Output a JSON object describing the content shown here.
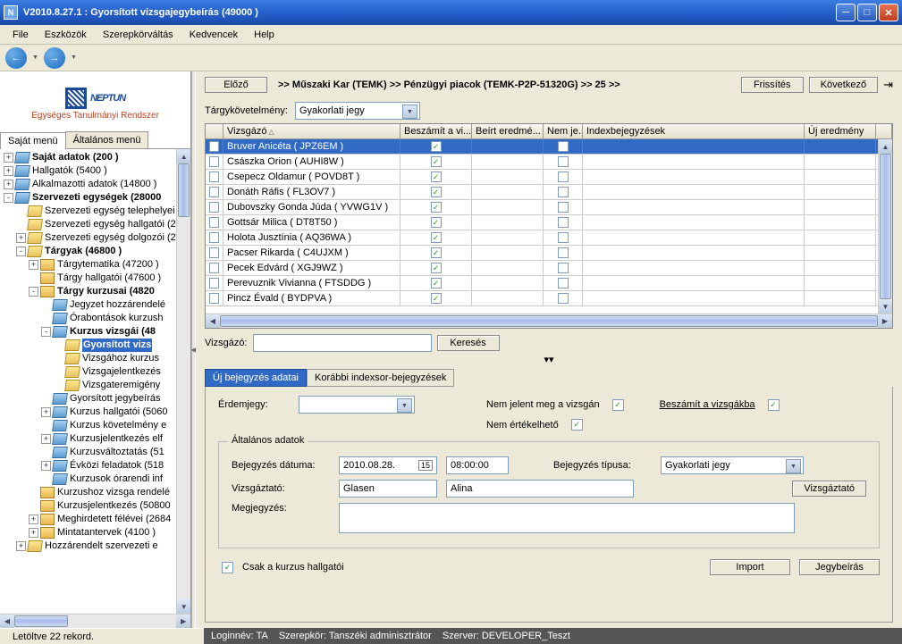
{
  "window": {
    "title": "V2010.8.27.1 : Gyorsított vizsgajegybeírás (49000  )",
    "icon_letter": "N"
  },
  "menu": [
    "File",
    "Eszközök",
    "Szerepkörváltás",
    "Kedvencek",
    "Help"
  ],
  "logo": {
    "brand": "NEPTUN",
    "tagline": "Egységes Tanulmányi Rendszer"
  },
  "left_tabs": {
    "active": "Saját menü",
    "other": "Általános menü"
  },
  "tree": [
    {
      "depth": 0,
      "exp": "+",
      "icon": "blue",
      "label": "Saját adatok (200  )",
      "bold": true
    },
    {
      "depth": 0,
      "exp": "+",
      "icon": "blue",
      "label": "Hallgatók (5400  )",
      "bold": false
    },
    {
      "depth": 0,
      "exp": "+",
      "icon": "blue",
      "label": "Alkalmazotti adatok (14800  )",
      "bold": false
    },
    {
      "depth": 0,
      "exp": "-",
      "icon": "blue",
      "label": "Szervezeti egységek (28000",
      "bold": true
    },
    {
      "depth": 1,
      "exp": "",
      "icon": "yellow",
      "label": "Szervezeti egység telephelyei",
      "bold": false
    },
    {
      "depth": 1,
      "exp": "",
      "icon": "yellow",
      "label": "Szervezeti egység hallgatói (2",
      "bold": false
    },
    {
      "depth": 1,
      "exp": "+",
      "icon": "yellow",
      "label": "Szervezeti egység dolgozói (2",
      "bold": false
    },
    {
      "depth": 1,
      "exp": "-",
      "icon": "yellow",
      "label": "Tárgyak (46800  )",
      "bold": true
    },
    {
      "depth": 2,
      "exp": "+",
      "icon": "folder",
      "label": "Tárgytematika (47200  )",
      "bold": false
    },
    {
      "depth": 2,
      "exp": "",
      "icon": "folder",
      "label": "Tárgy hallgatói (47600  )",
      "bold": false
    },
    {
      "depth": 2,
      "exp": "-",
      "icon": "folder",
      "label": "Tárgy kurzusai (4820",
      "bold": true
    },
    {
      "depth": 3,
      "exp": "",
      "icon": "blue",
      "label": "Jegyzet hozzárendelé",
      "bold": false
    },
    {
      "depth": 3,
      "exp": "",
      "icon": "blue",
      "label": "Órabontások kurzush",
      "bold": false
    },
    {
      "depth": 3,
      "exp": "-",
      "icon": "blue",
      "label": "Kurzus vizsgái (48",
      "bold": true
    },
    {
      "depth": 4,
      "exp": "",
      "icon": "yellow",
      "label": "Gyorsított vizs",
      "bold": true,
      "selected": true
    },
    {
      "depth": 4,
      "exp": "",
      "icon": "yellow",
      "label": "Vizsgához kurzus",
      "bold": false
    },
    {
      "depth": 4,
      "exp": "",
      "icon": "yellow",
      "label": "Vizsgajelentkezés",
      "bold": false
    },
    {
      "depth": 4,
      "exp": "",
      "icon": "yellow",
      "label": "Vizsgateremigény",
      "bold": false
    },
    {
      "depth": 3,
      "exp": "",
      "icon": "blue",
      "label": "Gyorsított jegybeírás",
      "bold": false
    },
    {
      "depth": 3,
      "exp": "+",
      "icon": "blue",
      "label": "Kurzus hallgatói (5060",
      "bold": false
    },
    {
      "depth": 3,
      "exp": "",
      "icon": "blue",
      "label": "Kurzus követelmény e",
      "bold": false
    },
    {
      "depth": 3,
      "exp": "+",
      "icon": "blue",
      "label": "Kurzusjelentkezés elf",
      "bold": false
    },
    {
      "depth": 3,
      "exp": "",
      "icon": "blue",
      "label": "Kurzusváltoztatás (51",
      "bold": false
    },
    {
      "depth": 3,
      "exp": "+",
      "icon": "blue",
      "label": "Évközi feladatok (518",
      "bold": false
    },
    {
      "depth": 3,
      "exp": "",
      "icon": "blue",
      "label": "Kurzusok órarendi inf",
      "bold": false
    },
    {
      "depth": 2,
      "exp": "",
      "icon": "folder",
      "label": "Kurzushoz vizsga rendelé",
      "bold": false
    },
    {
      "depth": 2,
      "exp": "",
      "icon": "folder",
      "label": "Kurzusjelentkezés (50800",
      "bold": false
    },
    {
      "depth": 2,
      "exp": "+",
      "icon": "folder",
      "label": "Meghirdetett félévei (2684",
      "bold": false
    },
    {
      "depth": 2,
      "exp": "+",
      "icon": "folder",
      "label": "Mintatantervek (4100  )",
      "bold": false
    },
    {
      "depth": 1,
      "exp": "+",
      "icon": "yellow",
      "label": "Hozzárendelt szervezeti e",
      "bold": false
    }
  ],
  "topnav": {
    "prev": "Előző",
    "breadcrumb": ">>  Műszaki Kar (TEMK) >> Pénzügyi piacok (TEMK-P2P-51320G) >> 25 >>",
    "refresh": "Frissítés",
    "next": "Következő"
  },
  "req": {
    "label": "Tárgykövetelmény:",
    "value": "Gyakorlati jegy"
  },
  "grid": {
    "headers": {
      "name": "Vizsgázó",
      "besz": "Beszámít a vi...",
      "beirt": "Beírt eredmé...",
      "nemj": "Nem je...",
      "index": "Indexbejegyzések",
      "ujer": "Új eredmény"
    },
    "rows": [
      {
        "name": "Bruver Anicéta ( JPZ6EM )",
        "besz": true,
        "nemj": false,
        "selected": true
      },
      {
        "name": "Császka Orion ( AUHI8W )",
        "besz": true,
        "nemj": false
      },
      {
        "name": "Csepecz Oldamur ( POVD8T )",
        "besz": true,
        "nemj": false
      },
      {
        "name": "Donáth Ráfis ( FL3OV7 )",
        "besz": true,
        "nemj": false
      },
      {
        "name": "Dubovszky Gonda Júda ( YVWG1V )",
        "besz": true,
        "nemj": false
      },
      {
        "name": "Gottsár Milica ( DT8T50 )",
        "besz": true,
        "nemj": false
      },
      {
        "name": "Holota Jusztínia ( AQ36WA )",
        "besz": true,
        "nemj": false
      },
      {
        "name": "Pacser Rikarda ( C4UJXM )",
        "besz": true,
        "nemj": false
      },
      {
        "name": "Pecek Edvárd ( XGJ9WZ )",
        "besz": true,
        "nemj": false
      },
      {
        "name": "Perevuznik Vivianna ( FTSDDG )",
        "besz": true,
        "nemj": false
      },
      {
        "name": "Pincz Évald ( BYDPVA )",
        "besz": true,
        "nemj": false
      }
    ]
  },
  "search": {
    "label": "Vizsgázó:",
    "button": "Keresés",
    "value": ""
  },
  "right_tabs": {
    "active": "Új bejegyzés adatai",
    "other": "Korábbi indexsor-bejegyzések"
  },
  "form": {
    "erdemjegy_label": "Érdemjegy:",
    "nemjelent_label": "Nem jelent meg a vizsgán",
    "nemjelent_checked": true,
    "beszamit_label": "Beszámít a vizsgákba",
    "beszamit_checked": true,
    "nemertekelheto_label": "Nem értékelhető",
    "nemertekelheto_checked": true
  },
  "fieldset": {
    "legend": "Általános adatok",
    "date_label": "Bejegyzés dátuma:",
    "date_value": "2010.08.28.",
    "time_value": "08:00:00",
    "type_label": "Bejegyzés típusa:",
    "type_value": "Gyakorlati jegy",
    "examiner_label": "Vizsgáztató:",
    "examiner_last": "Glasen",
    "examiner_first": "Alina",
    "examiner_btn": "Vizsgáztató",
    "note_label": "Megjegyzés:",
    "note_value": ""
  },
  "bottom": {
    "only_course": "Csak a kurzus hallgatói",
    "only_course_checked": true,
    "import": "Import",
    "write": "Jegybeírás"
  },
  "status": {
    "left": "Letöltve 22 rekord.",
    "login_lbl": "Loginnév:",
    "login": "TA",
    "role_lbl": "Szerepkör:",
    "role": "Tanszéki adminisztrátor",
    "server_lbl": "Szerver:",
    "server": "DEVELOPER_Teszt"
  }
}
